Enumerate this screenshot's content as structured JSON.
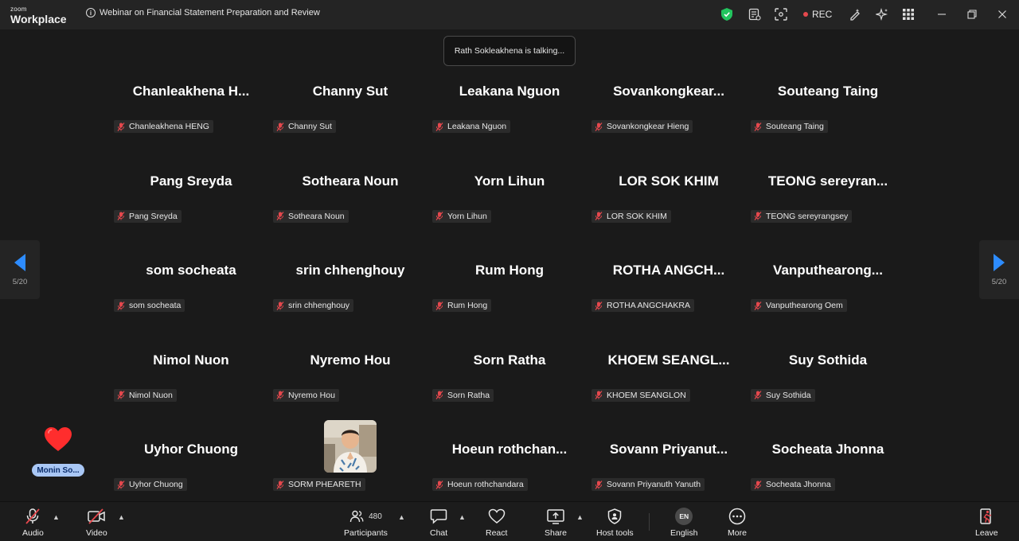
{
  "app": {
    "logo_top": "zoom",
    "logo_bottom": "Workplace"
  },
  "meeting": {
    "title": "Webinar on Financial Statement Preparation and Review"
  },
  "titlebar": {
    "rec_label": "REC"
  },
  "toast": {
    "text": "Rath Sokleakhena is talking..."
  },
  "pagination": {
    "left": "5/20",
    "right": "5/20"
  },
  "reaction": {
    "emoji": "heart",
    "name": "Monin  So..."
  },
  "participants": [
    {
      "display": "Chanleakhena  H...",
      "label": "Chanleakhena HENG"
    },
    {
      "display": "Channy Sut",
      "label": "Channy Sut"
    },
    {
      "display": "Leakana Nguon",
      "label": "Leakana Nguon"
    },
    {
      "display": "Sovankongkear...",
      "label": "Sovankongkear Hieng"
    },
    {
      "display": "Souteang Taing",
      "label": "Souteang Taing"
    },
    {
      "display": "Pang Sreyda",
      "label": "Pang Sreyda"
    },
    {
      "display": "Sotheara Noun",
      "label": "Sotheara Noun"
    },
    {
      "display": "Yorn Lihun",
      "label": "Yorn Lihun"
    },
    {
      "display": "LOR SOK KHIM",
      "label": "LOR SOK KHIM"
    },
    {
      "display": "TEONG  sereyran...",
      "label": "TEONG sereyrangsey"
    },
    {
      "display": "som socheata",
      "label": "som socheata"
    },
    {
      "display": "srin chhenghouy",
      "label": "srin chhenghouy"
    },
    {
      "display": "Rum Hong",
      "label": "Rum Hong"
    },
    {
      "display": "ROTHA  ANGCH...",
      "label": "ROTHA ANGCHAKRA"
    },
    {
      "display": "Vanputhearong...",
      "label": "Vanputhearong Oem"
    },
    {
      "display": "Nimol Nuon",
      "label": "Nimol Nuon"
    },
    {
      "display": "Nyremo Hou",
      "label": "Nyremo Hou"
    },
    {
      "display": "Sorn Ratha",
      "label": "Sorn Ratha"
    },
    {
      "display": "KHOEM  SEANGL...",
      "label": "KHOEM SEANGLON"
    },
    {
      "display": "Suy Sothida",
      "label": "Suy Sothida"
    },
    {
      "display": "Uyhor Chuong",
      "label": "Uyhor Chuong"
    },
    {
      "display": "",
      "label": "SORM PHEARETH",
      "photo": true
    },
    {
      "display": "Hoeun  rothchan...",
      "label": "Hoeun rothchandara"
    },
    {
      "display": "Sovann  Priyanut...",
      "label": "Sovann Priyanuth Yanuth"
    },
    {
      "display": "Socheata Jhonna",
      "label": "Socheata Jhonna"
    }
  ],
  "toolbar": {
    "audio": "Audio",
    "video": "Video",
    "participants": "Participants",
    "participants_count": "480",
    "chat": "Chat",
    "react": "React",
    "share": "Share",
    "host_tools": "Host tools",
    "language": "English",
    "language_code": "EN",
    "more": "More",
    "leave": "Leave"
  },
  "colors": {
    "accent": "#2d8cff",
    "muted_red": "#e5484d",
    "shield_green": "#22c55e",
    "leave_red": "#e5484d"
  }
}
